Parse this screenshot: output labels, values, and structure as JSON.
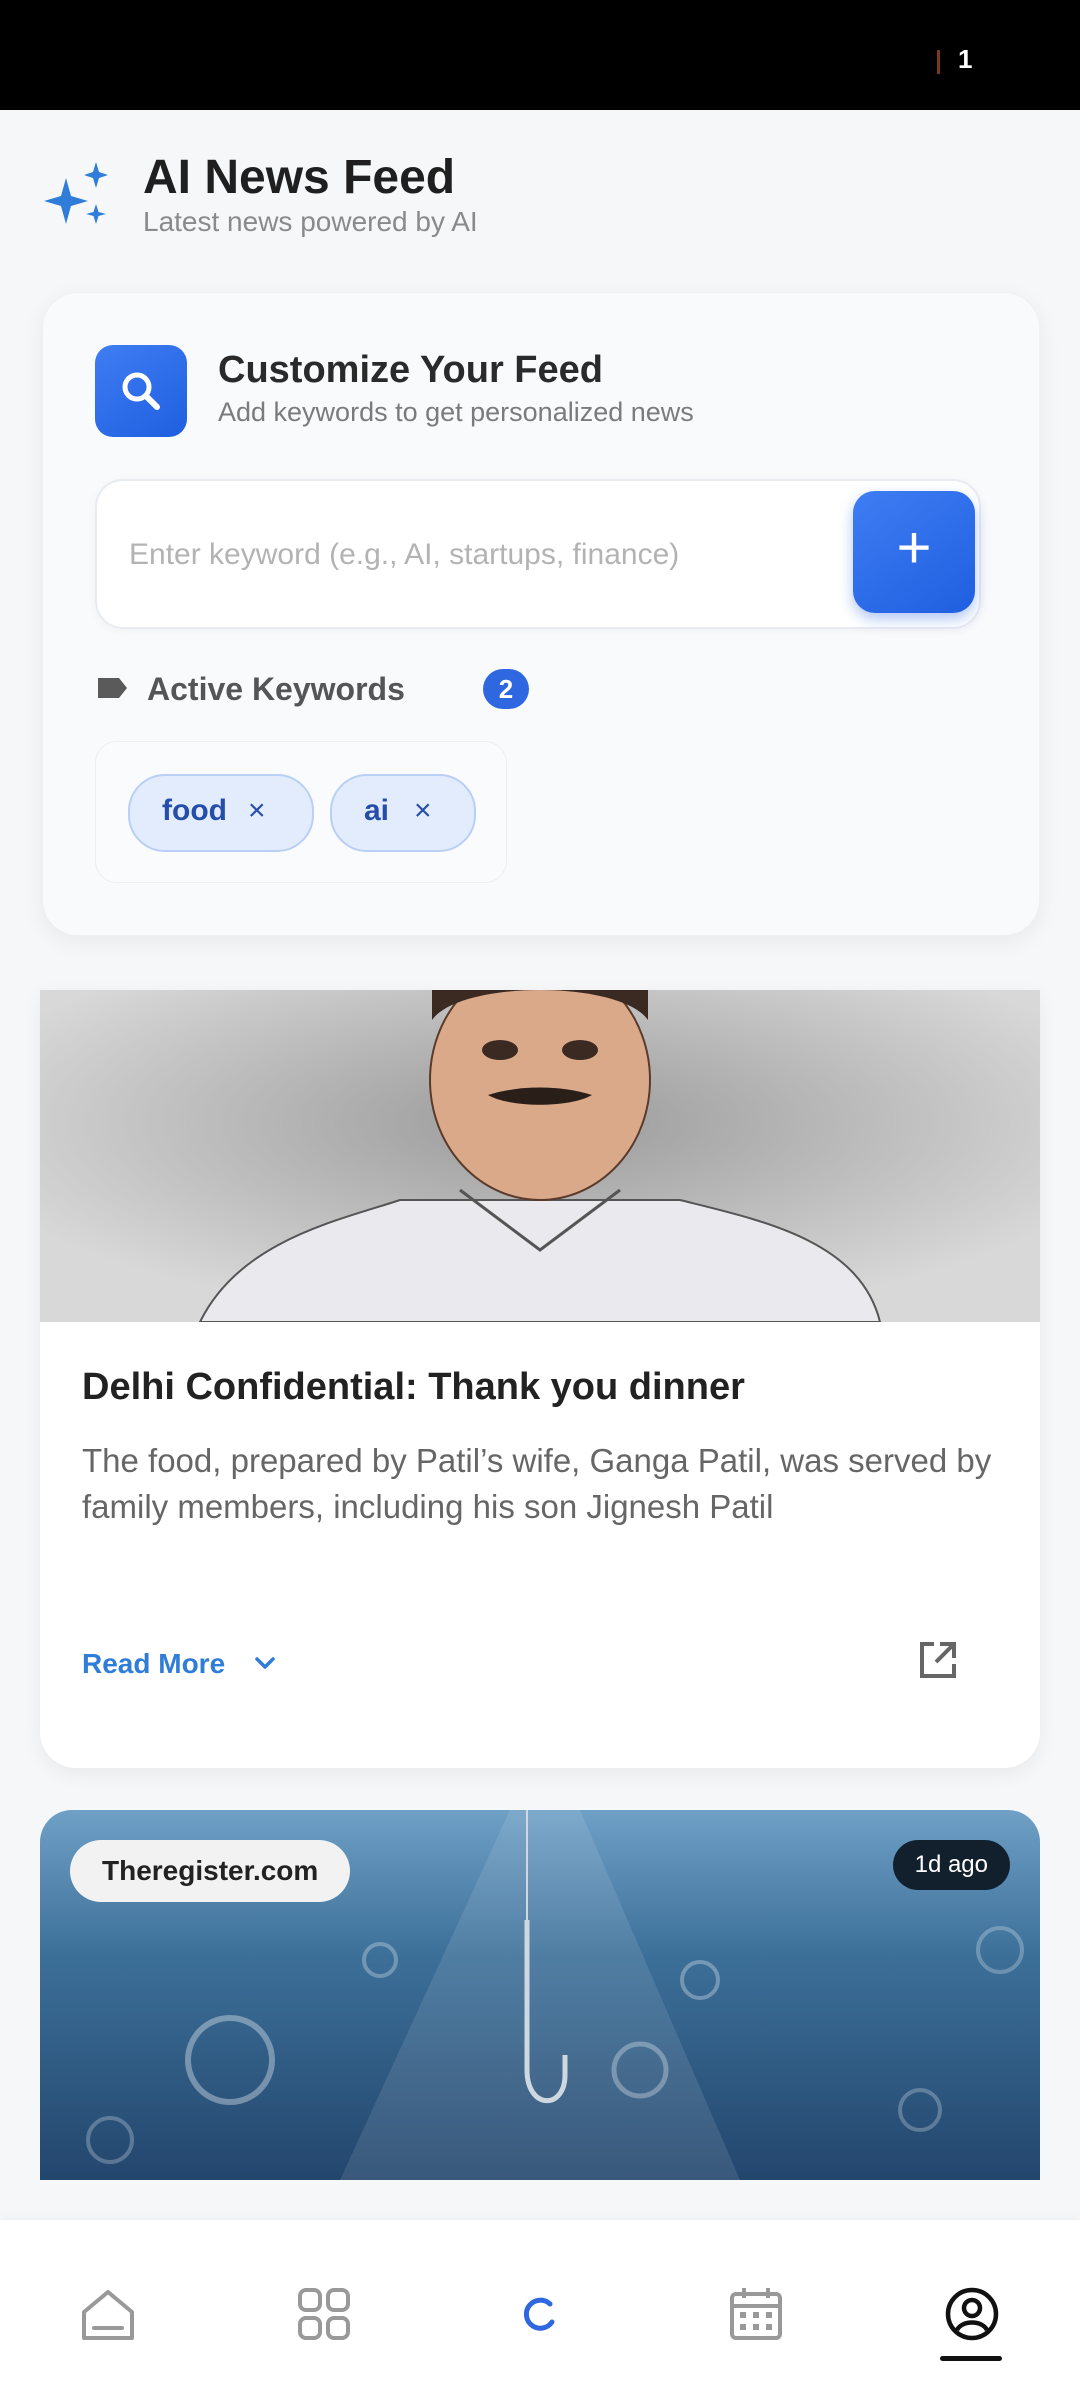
{
  "status_bar": {
    "indicator": "1"
  },
  "header": {
    "title": "AI News Feed",
    "subtitle": "Latest news powered by AI"
  },
  "customize": {
    "title": "Customize Your Feed",
    "subtitle": "Add keywords to get personalized news",
    "input_placeholder": "Enter keyword (e.g., AI, startups, finance)",
    "add_button_label": "+",
    "active_keywords_label": "Active Keywords",
    "active_count": "2",
    "keywords": [
      {
        "label": "food",
        "remove_glyph": "×"
      },
      {
        "label": "ai",
        "remove_glyph": "×"
      }
    ]
  },
  "articles": [
    {
      "title": "Delhi Confidential: Thank you dinner",
      "description": "The food, prepared by Patil’s wife, Ganga Patil, was served by family members, including his son Jignesh Patil",
      "read_more": "Read More"
    },
    {
      "source": "Theregister.com",
      "time_ago": "1d ago"
    }
  ],
  "bottom_nav": {
    "items": [
      "home-icon",
      "grid-icon",
      "loading-icon",
      "calendar-icon",
      "profile-icon"
    ],
    "active": "profile-icon"
  },
  "colors": {
    "accent": "#2e67df",
    "link": "#2f7dd8",
    "chip_bg": "#e3ecfc"
  }
}
